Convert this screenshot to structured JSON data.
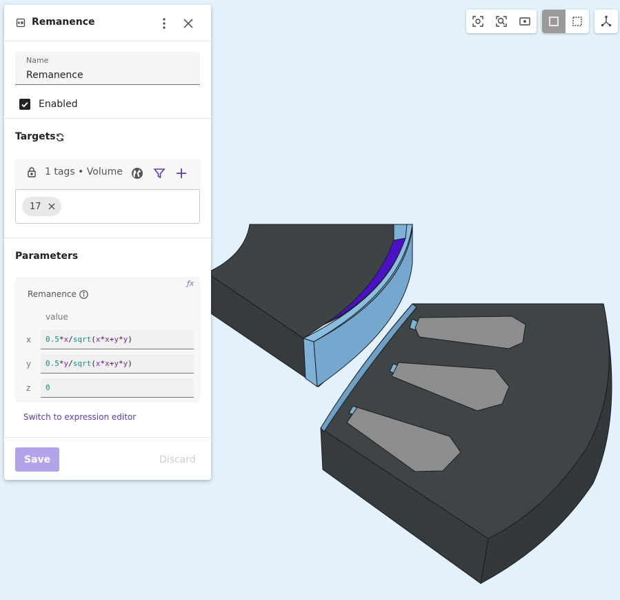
{
  "colors": {
    "background": "#e3f1fc",
    "accent": "#5a3bb4",
    "save_disabled": "#b3a3ea",
    "model_dark": "#3d4245",
    "magnet_blue": "#7eb1d6",
    "selected_purple": "#4a12c4",
    "slot_gray": "#8d8d8d"
  },
  "toolbar": {
    "groups": [
      [
        "zoom-fit-icon",
        "zoom-selection-icon",
        "frame-icon"
      ],
      [
        "solid-view-icon",
        "wireframe-view-icon"
      ],
      [
        "axes-icon"
      ]
    ],
    "active": "solid-view-icon"
  },
  "panel": {
    "title": "Remanence",
    "name_label": "Name",
    "name_value": "Remanence",
    "enabled_label": "Enabled",
    "enabled": true,
    "targets_title": "Targets",
    "targets_summary": "1 tags • Volume",
    "tags": [
      "17"
    ],
    "parameters_title": "Parameters",
    "parameter_name": "Remanence",
    "value_header": "value",
    "rows": [
      {
        "axis": "x",
        "expression": "0.5*x/sqrt(x*x+y*y)"
      },
      {
        "axis": "y",
        "expression": "0.5*y/sqrt(x*x+y*y)"
      },
      {
        "axis": "z",
        "expression": "0"
      }
    ],
    "switch_link": "Switch to expression editor",
    "save_label": "Save",
    "discard_label": "Discard"
  }
}
